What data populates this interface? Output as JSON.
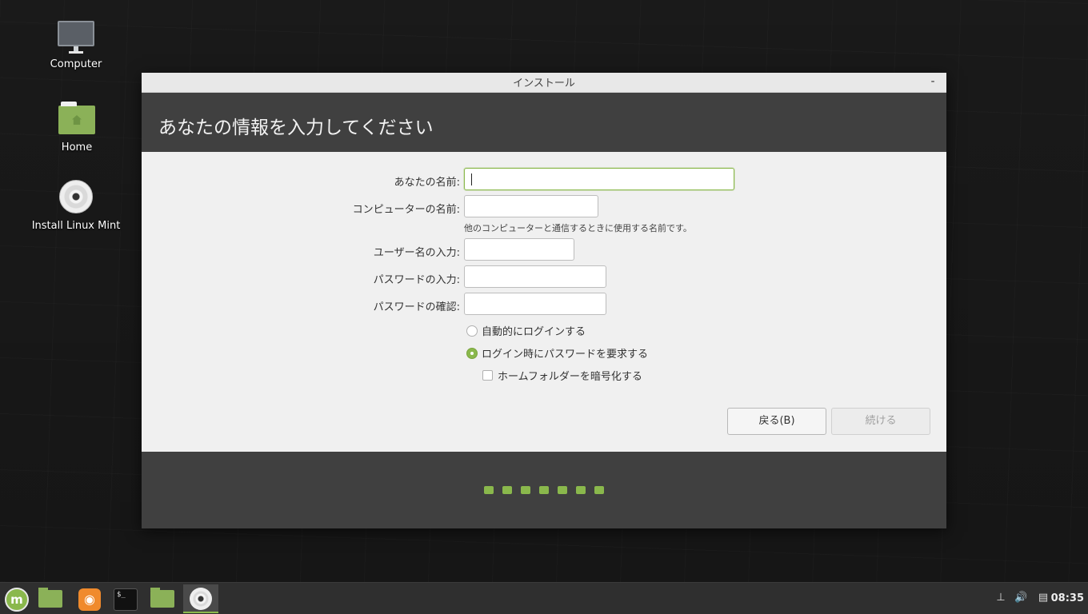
{
  "desktop": {
    "icons": [
      {
        "label": "Computer",
        "icon": "computer-icon"
      },
      {
        "label": "Home",
        "icon": "home-folder-icon"
      },
      {
        "label": "Install Linux Mint",
        "icon": "disc-icon"
      }
    ]
  },
  "window": {
    "title": "インストール",
    "minimize_label": "-",
    "heading": "あなたの情報を入力してください",
    "form": {
      "your_name_label": "あなたの名前:",
      "your_name_value": "",
      "computer_name_label": "コンピューターの名前:",
      "computer_name_value": "",
      "computer_name_hint": "他のコンピューターと通信するときに使用する名前です。",
      "username_label": "ユーザー名の入力:",
      "username_value": "",
      "password_label": "パスワードの入力:",
      "password_value": "",
      "password_confirm_label": "パスワードの確認:",
      "password_confirm_value": ""
    },
    "options": {
      "auto_login_label": "自動的にログインする",
      "auto_login_selected": false,
      "require_password_label": "ログイン時にパスワードを要求する",
      "require_password_selected": true,
      "encrypt_home_label": "ホームフォルダーを暗号化する",
      "encrypt_home_checked": false
    },
    "buttons": {
      "back": "戻る(B)",
      "continue": "続ける"
    },
    "progress": {
      "total_steps": 7
    }
  },
  "taskbar": {
    "items": [
      "menu-icon",
      "show-desktop-icon",
      "browser-icon",
      "terminal-icon",
      "files-icon",
      "installer-icon"
    ],
    "tray": [
      "network-icon",
      "volume-icon",
      "clipboard-icon"
    ],
    "clock": "08:35"
  },
  "colors": {
    "accent": "#8ab84c",
    "header_bg": "#404040",
    "window_bg": "#f0f0f0"
  }
}
